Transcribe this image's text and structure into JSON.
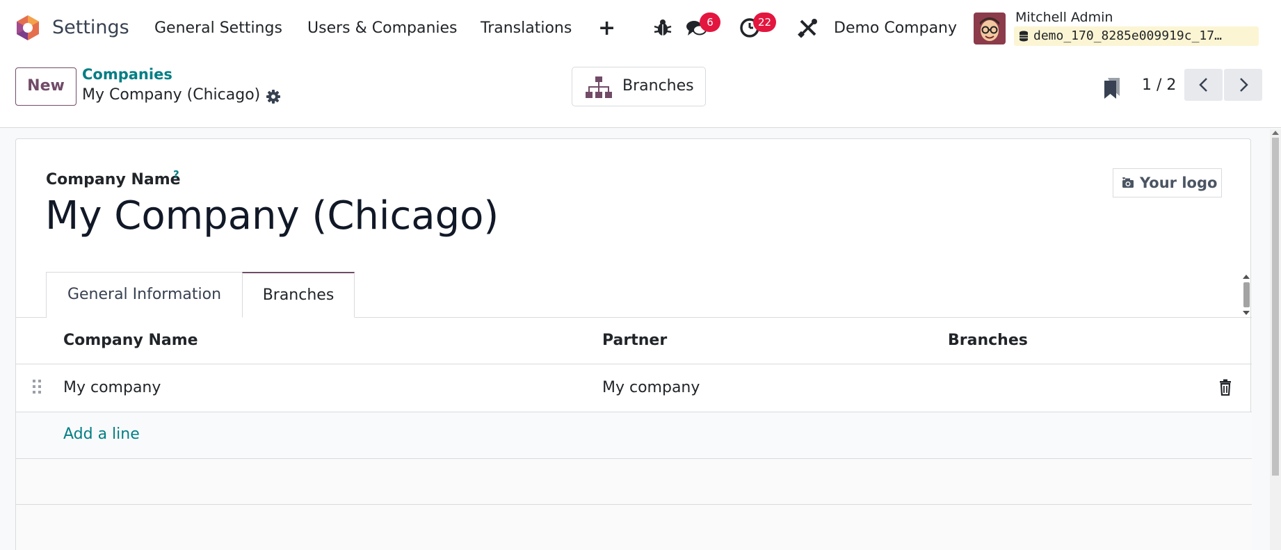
{
  "navbar": {
    "app_name": "Settings",
    "menus": [
      "General Settings",
      "Users & Companies",
      "Translations"
    ],
    "plus_label": "+",
    "messages_count": "6",
    "activities_count": "22",
    "company": "Demo Company",
    "user_name": "Mitchell Admin",
    "database": "demo_170_8285e009919c_17…"
  },
  "control": {
    "new_label": "New",
    "breadcrumb_parent": "Companies",
    "breadcrumb_current": "My Company (Chicago)",
    "smart_button_label": "Branches",
    "pager": "1 / 2"
  },
  "form": {
    "field_label": "Company Name",
    "help_mark": "?",
    "company_name": "My Company (Chicago)",
    "logo_label": "Your logo",
    "tabs": [
      "General Information",
      "Branches"
    ],
    "active_tab": "Branches",
    "table": {
      "headers": [
        "Company Name",
        "Partner",
        "Branches"
      ],
      "rows": [
        {
          "company": "My company",
          "partner": "My company",
          "branches": ""
        }
      ],
      "add_line": "Add a line"
    }
  },
  "colors": {
    "brand": "#714b67",
    "link": "#017e84",
    "badge": "#e3163f",
    "db_chip": "#fbf5d4"
  },
  "icons": [
    "odoo-logo-icon",
    "bug-icon",
    "chat-icon",
    "clock-icon",
    "tools-icon",
    "gear-icon",
    "hierarchy-icon",
    "bookmark-icon",
    "chevron-left-icon",
    "chevron-right-icon",
    "camera-icon",
    "drag-handle-icon",
    "trash-icon",
    "database-icon"
  ]
}
